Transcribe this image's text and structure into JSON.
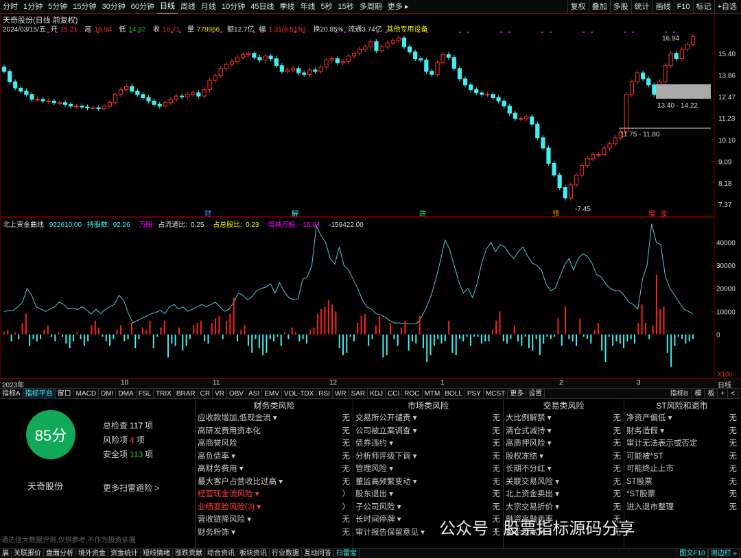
{
  "toolbar": {
    "periods": [
      "分时",
      "1分钟",
      "5分钟",
      "15分钟",
      "30分钟",
      "60分钟",
      "日线",
      "周线",
      "月线",
      "10分钟",
      "45日线",
      "季线",
      "年线",
      "5秒",
      "15秒",
      "多周期",
      "更多 ▸"
    ],
    "active_period": "日线",
    "right": [
      "复权",
      "叠加",
      "多股",
      "统计",
      "画线",
      "F10",
      "标记",
      "+自选"
    ]
  },
  "kline": {
    "title": "天奇股份(日线 前复权)",
    "date": "2024/03/15/五",
    "open_label": "开",
    "open": "15.21",
    "high_label": "高",
    "high": "16.94",
    "low_label": "低",
    "low": "14.82",
    "close_label": "收",
    "close": "16.71",
    "vol_label": "量",
    "vol": "778966",
    "amount": "额12.7亿",
    "change_label": "幅",
    "change": "1.31(8.51%)",
    "turnover": "换20.85%",
    "float": "流通3.74亿",
    "concept": "其他专用设备",
    "price_ticks": [
      "15.40",
      "13.86",
      "12.47",
      "11.23",
      "10.10",
      "9.09",
      "8.18",
      "7.37"
    ],
    "ann_high": "16.94",
    "ann_low": "7.45",
    "box1": "13.40 - 14.22",
    "box2": "11.75 - 11.80",
    "events": [
      "财",
      "解",
      "跌",
      "预",
      "增",
      "涨"
    ]
  },
  "indicator": {
    "name": "北上资金曲线",
    "value": "922610.00",
    "hold_label": "持股数:",
    "hold": "92.26",
    "unit": "万股",
    "ratio_label": "占流通比:",
    "ratio": "0.25",
    "total_label": "占总股比:",
    "total": "0.23",
    "chg_label": "增减万股:",
    "chg": "-15.94",
    "last": "-159422.00",
    "y_ticks": [
      "40000",
      "30000",
      "20000",
      "10000",
      "0"
    ],
    "x100": "X100"
  },
  "axis": {
    "months": [
      "2023年",
      "10",
      "11",
      "12",
      "1",
      "2",
      "3"
    ],
    "period": "日线"
  },
  "tabs": [
    "指标A",
    "指标平台",
    "窗口",
    "MACD",
    "DMI",
    "DMA",
    "FSL",
    "TRIX",
    "BRAR",
    "CR",
    "VR",
    "OBV",
    "ASI",
    "EMV",
    "VOL-TDX",
    "RSI",
    "WR",
    "SAR",
    "KDJ",
    "CCI",
    "ROC",
    "MTM",
    "BOLL",
    "PSY",
    "MCST",
    "更多",
    "设置"
  ],
  "active_tab": "指标平台",
  "tabs_right": [
    "指标B",
    "模",
    "板",
    "+",
    "<"
  ],
  "scan": {
    "score": "85分",
    "total_label": "总检查",
    "total": "117",
    "unit": "项",
    "risk_label": "风险项",
    "risk": "4",
    "safe_label": "安全项",
    "safe": "113",
    "stock": "天奇股份",
    "more": "更多扫雷避险 >",
    "disclaimer": "通达信大数据评测,仅供参考,不作为投资依据"
  },
  "risk_cols": [
    {
      "title": "财务类风险",
      "rows": [
        {
          "label": "应收款增加,低现金流 ▾",
          "val": "无"
        },
        {
          "label": "高研发费用资本化",
          "val": "无"
        },
        {
          "label": "高商誉风险",
          "val": "无"
        },
        {
          "label": "高负债率 ▾",
          "val": "无"
        },
        {
          "label": "高财务费用 ▾",
          "val": "无"
        },
        {
          "label": "最大客户占营收比过高 ▾",
          "val": "无"
        },
        {
          "label": "经营现金流风险 ▾",
          "val": "〉",
          "hot": true
        },
        {
          "label": "业绩变脸风险(3) ▾",
          "val": "〉",
          "hot": true
        },
        {
          "label": "营收链降风险 ▾",
          "val": "无"
        },
        {
          "label": "财务粉饰 ▾",
          "val": "无"
        }
      ]
    },
    {
      "title": "市场类风险",
      "rows": [
        {
          "label": "交易所公开谴责 ▾",
          "val": "无"
        },
        {
          "label": "公司被立案调查 ▾",
          "val": "无"
        },
        {
          "label": "债券违约 ▾",
          "val": "无"
        },
        {
          "label": "分析师评级下调 ▾",
          "val": "无"
        },
        {
          "label": "管理风险 ▾",
          "val": "无"
        },
        {
          "label": "董监高频繁变动 ▾",
          "val": "无"
        },
        {
          "label": "股东退出 ▾",
          "val": "无"
        },
        {
          "label": "子公司风险 ▾",
          "val": "无"
        },
        {
          "label": "长时间停牌 ▾",
          "val": "无"
        },
        {
          "label": "审计报告保留意见 ▾",
          "val": "无"
        }
      ]
    },
    {
      "title": "交易类风险",
      "rows": [
        {
          "label": "大比例解禁 ▾",
          "val": "无"
        },
        {
          "label": "清仓式减持 ▾",
          "val": "无"
        },
        {
          "label": "高质押风险 ▾",
          "val": "无"
        },
        {
          "label": "股权冻结 ▾",
          "val": "无"
        },
        {
          "label": "长期不分红 ▾",
          "val": "无"
        },
        {
          "label": "关联交易风险 ▾",
          "val": "无"
        },
        {
          "label": "北上资金卖出 ▾",
          "val": "无"
        },
        {
          "label": "大宗交易折价 ▾",
          "val": "无"
        },
        {
          "label": "融资高融卖率",
          "val": "无"
        },
        {
          "label": "换手过高 ▾",
          "val": "无"
        }
      ]
    },
    {
      "title": "ST风险和退市",
      "rows": [
        {
          "label": "净资产偏低 ▾",
          "val": "无"
        },
        {
          "label": "财务造假 ▾",
          "val": "无"
        },
        {
          "label": "审计无法表示或否定",
          "val": "无"
        },
        {
          "label": "可能被*ST",
          "val": "无"
        },
        {
          "label": "可能终止上市",
          "val": "无"
        },
        {
          "label": "ST股票",
          "val": "无"
        },
        {
          "label": "*ST股票",
          "val": "无"
        },
        {
          "label": "进入退市整理",
          "val": "无"
        }
      ]
    }
  ],
  "watermark": "公众号 · 股票指标源码分享",
  "bottom_tabs": [
    "展",
    "关联报价",
    "盘面分析",
    "境外资金",
    "资金统计",
    "短线情绪",
    "涨跌贡献",
    "综合资讯",
    "板块资讯",
    "行业数据",
    "互动问答",
    "扫雷宝"
  ],
  "active_bottom": "扫雷宝",
  "bottom_right": [
    "图文F10",
    "测边栏 »"
  ],
  "colors": {
    "up": "#ff3030",
    "down": "#4ee",
    "accent": "#12a85a"
  }
}
